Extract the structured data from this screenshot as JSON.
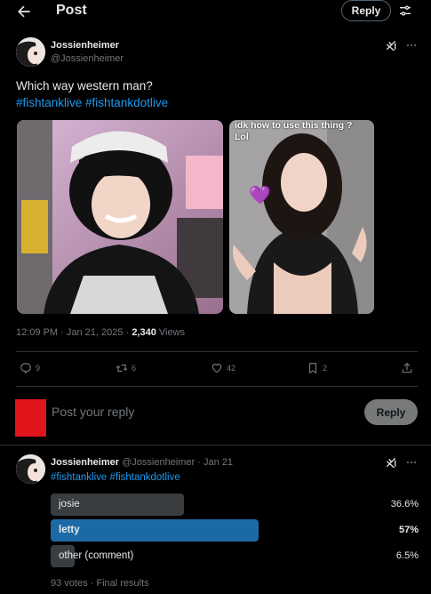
{
  "header": {
    "title": "Post",
    "reply_label": "Reply"
  },
  "post": {
    "author_name": "Jossienheimer",
    "author_handle": "@Jossienheimer",
    "text_line1": "Which way western man?",
    "text_line2": "#fishtanklive #fishtankdotlive",
    "image2_caption": "idk how to use this thing ? Lol",
    "time": "12:09 PM",
    "date": "Jan 21, 2025",
    "views_count": "2,340",
    "views_label": "Views",
    "separator": "·",
    "actions": {
      "replies": "9",
      "reposts": "6",
      "likes": "42",
      "bookmarks": "2"
    }
  },
  "composer": {
    "placeholder": "Post your reply",
    "reply_label": "Reply"
  },
  "reply": {
    "author_name": "Jossienheimer",
    "author_handle": "@Jossienheimer",
    "date": "Jan 21",
    "separator": "·",
    "text": "#fishtanklive #fishtankdotlive",
    "poll": {
      "options": [
        {
          "label": "josie",
          "percent": "36.6%",
          "value": 36.6,
          "leading": false
        },
        {
          "label": "letty",
          "percent": "57%",
          "value": 57,
          "leading": true
        },
        {
          "label": "other (comment)",
          "percent": "6.5%",
          "value": 6.5,
          "leading": false
        }
      ],
      "summary": "93 votes · Final results"
    }
  },
  "colors": {
    "accent": "#1d9bf0",
    "poll_leading": "#1b6aa6",
    "poll_other": "#3a3d40",
    "avatar_placeholder": "#e0141b"
  }
}
